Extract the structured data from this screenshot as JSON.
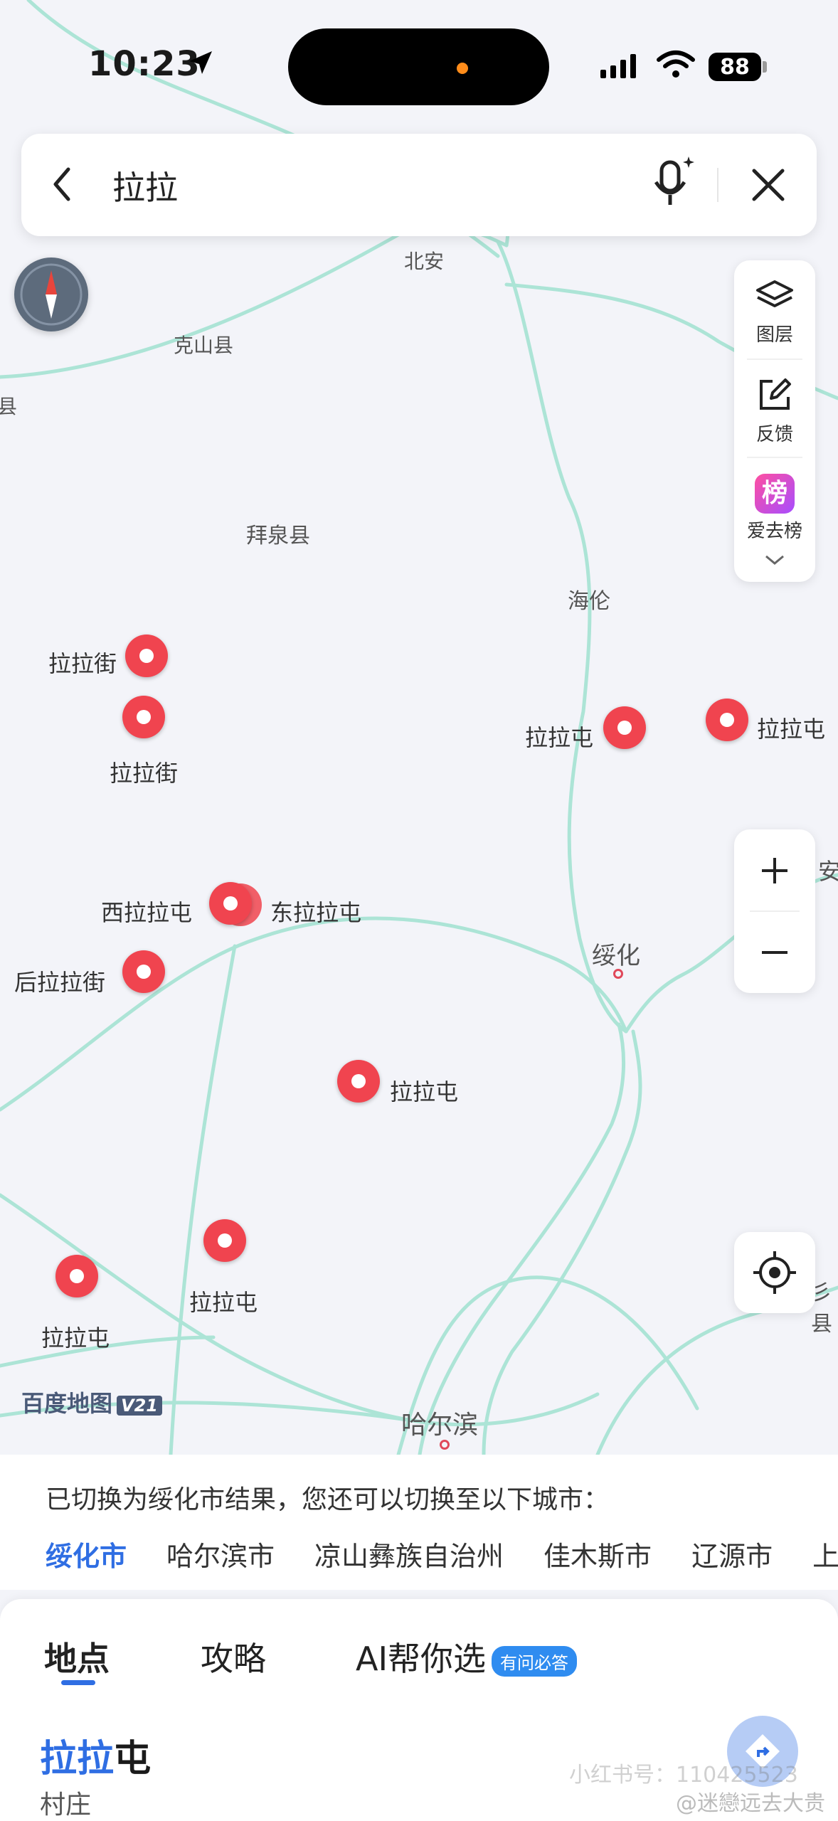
{
  "status_bar": {
    "time": "10:23",
    "battery": "88"
  },
  "search": {
    "query": "拉拉"
  },
  "map": {
    "places": [
      {
        "name": "北安"
      },
      {
        "name": "克山县"
      },
      {
        "name": "县"
      },
      {
        "name": "拜泉县"
      },
      {
        "name": "海伦"
      },
      {
        "name": "绥化"
      },
      {
        "name": "哈尔滨"
      },
      {
        "name": "安"
      },
      {
        "name": "彡县"
      }
    ],
    "markers": [
      {
        "label": "拉拉街"
      },
      {
        "label": "拉拉街"
      },
      {
        "label": "拉拉屯"
      },
      {
        "label": "拉拉屯"
      },
      {
        "label": "西拉拉屯"
      },
      {
        "label": "东拉拉屯"
      },
      {
        "label": "后拉拉街"
      },
      {
        "label": "拉拉屯"
      },
      {
        "label": "拉拉屯"
      },
      {
        "label": "拉拉屯"
      }
    ],
    "logo_text": "百度地图",
    "logo_version": "V21"
  },
  "side_panel": {
    "layers_label": "图层",
    "feedback_label": "反馈",
    "bang_badge": "榜",
    "bang_label": "爱去榜"
  },
  "city_switch": {
    "notice": "已切换为绥化市结果，您还可以切换至以下城市：",
    "cities": [
      "绥化市",
      "哈尔滨市",
      "凉山彝族自治州",
      "佳木斯市",
      "辽源市",
      "上"
    ]
  },
  "tabs": {
    "places": "地点",
    "guides": "攻略",
    "ai": "AI帮你选",
    "ai_badge": "有问必答"
  },
  "result": {
    "title_highlight": "拉拉",
    "title_rest": "屯",
    "subtitle": "村庄"
  },
  "watermark": {
    "line1": "小红书号：110425523",
    "line2": "@迷戀远去大贵"
  },
  "colors": {
    "accent": "#2f6ee3",
    "marker": "#f0444f",
    "road": "#a8e2d4"
  }
}
